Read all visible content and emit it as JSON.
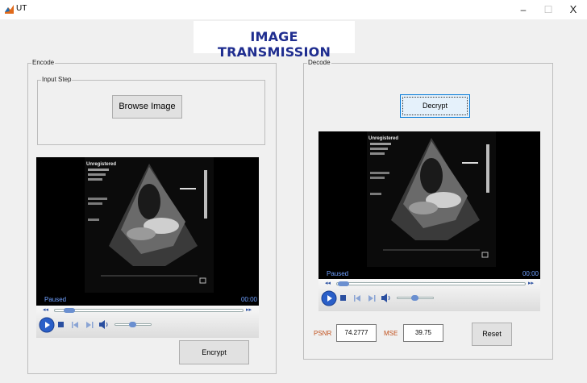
{
  "window": {
    "title": "UT",
    "minimize": "–",
    "maximize": "☐",
    "close": "X"
  },
  "banner": {
    "title": "IMAGE TRANSMISSION"
  },
  "encode": {
    "panel_label": "Encode",
    "input_step_label": "Input Step",
    "browse_button": "Browse Image",
    "player": {
      "status": "Paused",
      "time": "00:00",
      "seek_fraction": 0.1,
      "volume_fraction": 0.5
    },
    "encrypt_button": "Encrypt"
  },
  "decode": {
    "panel_label": "Decode",
    "decrypt_button": "Decrypt",
    "player": {
      "status": "Paused",
      "time": "00:00",
      "seek_fraction": 0.05,
      "volume_fraction": 0.5
    },
    "psnr_label": "PSNR",
    "psnr_value": "74.2777",
    "mse_label": "MSE",
    "mse_value": "39.75",
    "reset_button": "Reset"
  },
  "colors": {
    "banner_text": "#1f2d8f",
    "metric_label": "#c0501c",
    "player_text": "#6fa0ff"
  }
}
